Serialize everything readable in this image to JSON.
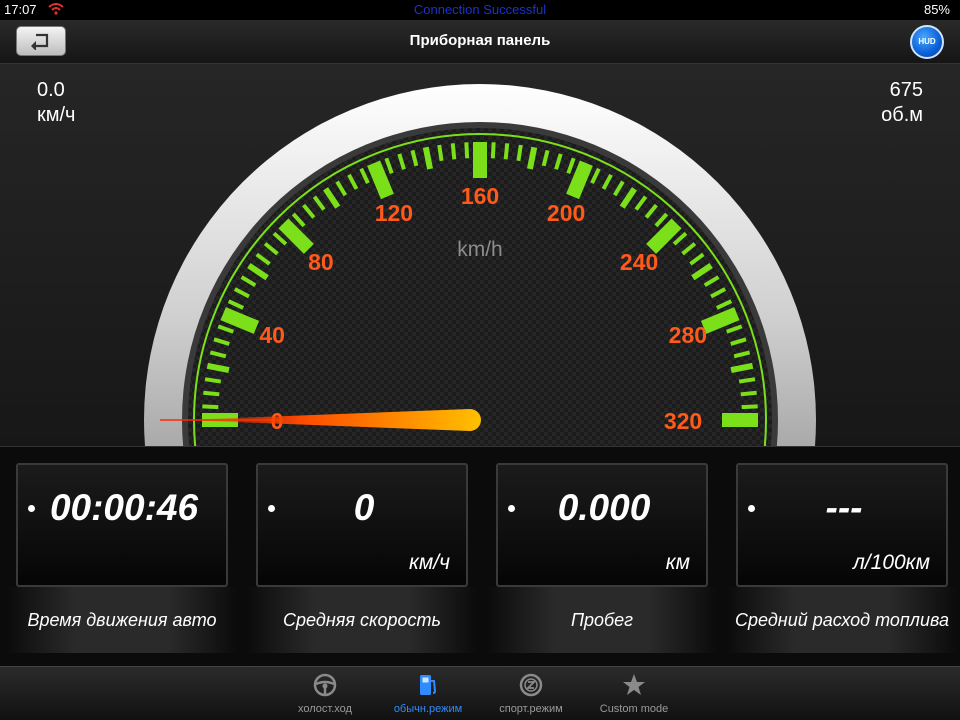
{
  "status_bar": {
    "time": "17:07",
    "center_text": "Connection Successful",
    "battery": "85%"
  },
  "nav": {
    "title": "Приборная панель",
    "hud_label": "HUD"
  },
  "readouts": {
    "speed_value": "0.0",
    "speed_unit": "км/ч",
    "rpm_value": "675",
    "rpm_unit": "об.м"
  },
  "gauge": {
    "unit": "km/h",
    "tick_labels": [
      "0",
      "40",
      "80",
      "120",
      "160",
      "200",
      "240",
      "280",
      "320"
    ],
    "min": 0,
    "max": 320,
    "needle_value": 0,
    "colors": {
      "ticks": "#7be01a",
      "labels": "#ff5a1a",
      "needle": "#ffb000"
    }
  },
  "panels": [
    {
      "value": "00:00:46",
      "unit": "",
      "label": "Время движения авто"
    },
    {
      "value": "0",
      "unit": "км/ч",
      "label": "Средняя скорость"
    },
    {
      "value": "0.000",
      "unit": "км",
      "label": "Пробег"
    },
    {
      "value": "---",
      "unit": "л/100км",
      "label": "Средний расход топлива"
    }
  ],
  "tabs": [
    {
      "label": "холост.ход",
      "icon": "steering-wheel-icon",
      "active": false
    },
    {
      "label": "обычн.режим",
      "icon": "fuel-pump-icon",
      "active": true
    },
    {
      "label": "спорт.режим",
      "icon": "sport-icon",
      "active": false
    },
    {
      "label": "Custom mode",
      "icon": "star-icon",
      "active": false
    }
  ],
  "colors": {
    "accent": "#2f8cff",
    "status_center": "#1a33cc"
  }
}
